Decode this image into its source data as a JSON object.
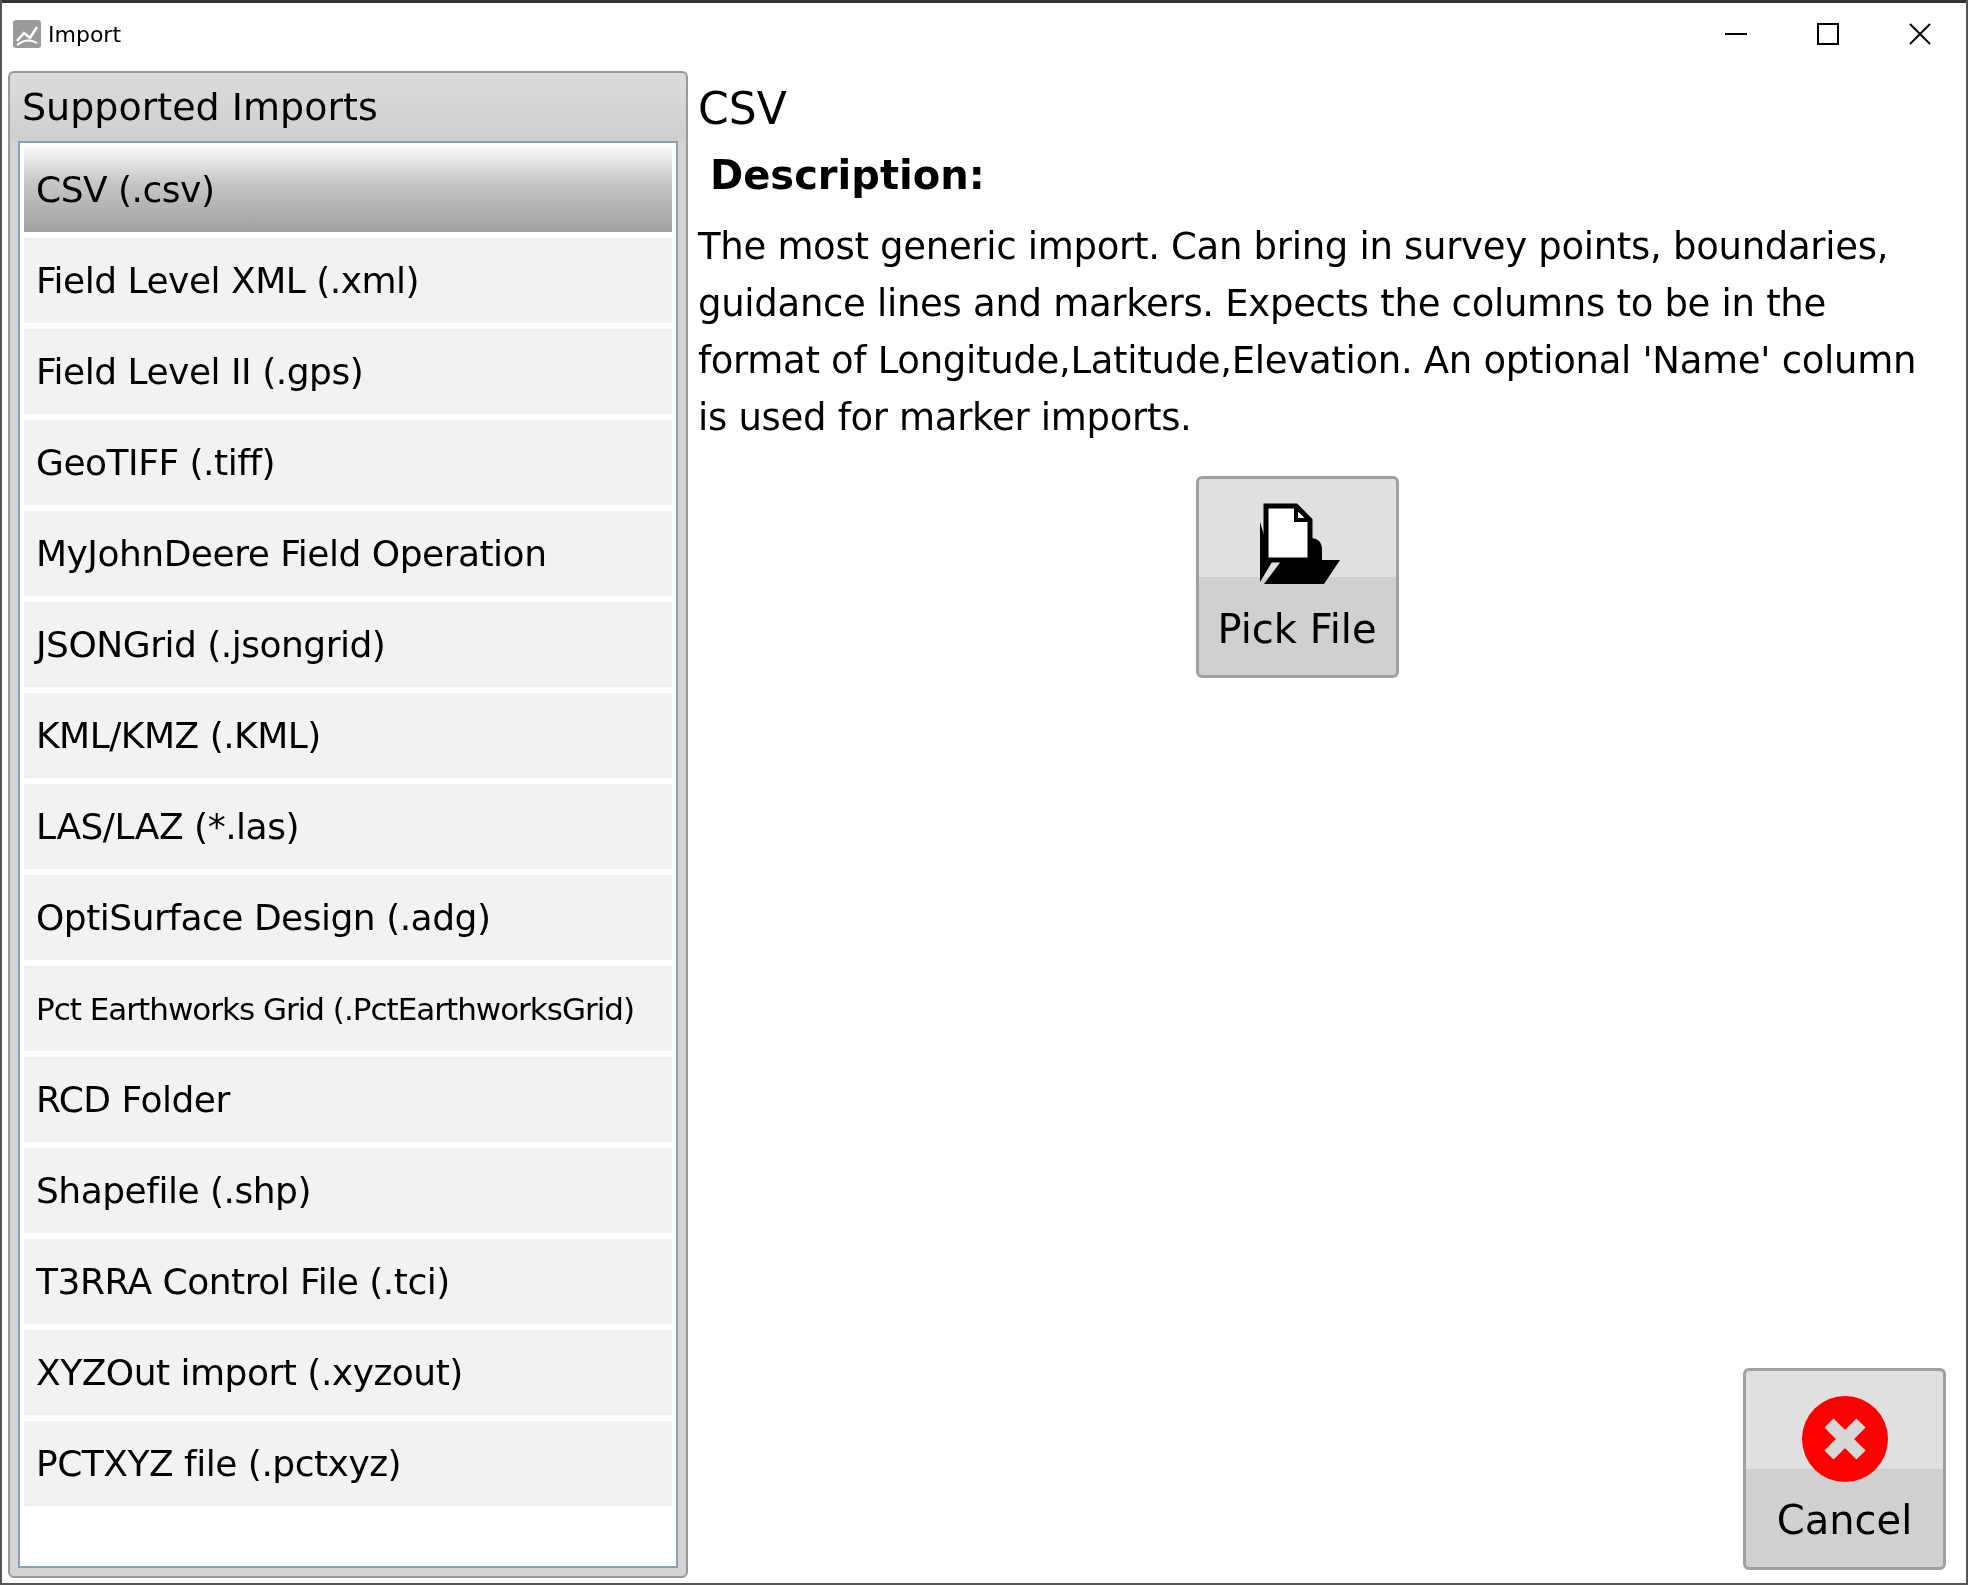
{
  "window": {
    "title": "Import"
  },
  "sidebar": {
    "title": "Supported Imports",
    "items": [
      {
        "label": "CSV (.csv)",
        "selected": true
      },
      {
        "label": "Field Level XML (.xml)",
        "selected": false
      },
      {
        "label": "Field Level II (.gps)",
        "selected": false
      },
      {
        "label": "GeoTIFF (.tiff)",
        "selected": false
      },
      {
        "label": "MyJohnDeere Field Operation",
        "selected": false
      },
      {
        "label": "JSONGrid (.jsongrid)",
        "selected": false
      },
      {
        "label": "KML/KMZ (.KML)",
        "selected": false
      },
      {
        "label": "LAS/LAZ (*.las)",
        "selected": false
      },
      {
        "label": "OptiSurface Design (.adg)",
        "selected": false
      },
      {
        "label": "Pct Earthworks Grid (.PctEarthworksGrid)",
        "selected": false
      },
      {
        "label": "RCD Folder",
        "selected": false
      },
      {
        "label": "Shapefile (.shp)",
        "selected": false
      },
      {
        "label": "T3RRA Control File (.tci)",
        "selected": false
      },
      {
        "label": "XYZOut import (.xyzout)",
        "selected": false
      },
      {
        "label": "PCTXYZ file (.pctxyz)",
        "selected": false
      }
    ]
  },
  "detail": {
    "title": "CSV",
    "description_label": "Description:",
    "description": "The most generic import. Can bring in survey points, boundaries, guidance lines and markers. Expects the columns to be in the format of Longitude,Latitude,Elevation. An optional 'Name' column is used for marker imports.",
    "pick_button": "Pick File"
  },
  "cancel_button": "Cancel"
}
